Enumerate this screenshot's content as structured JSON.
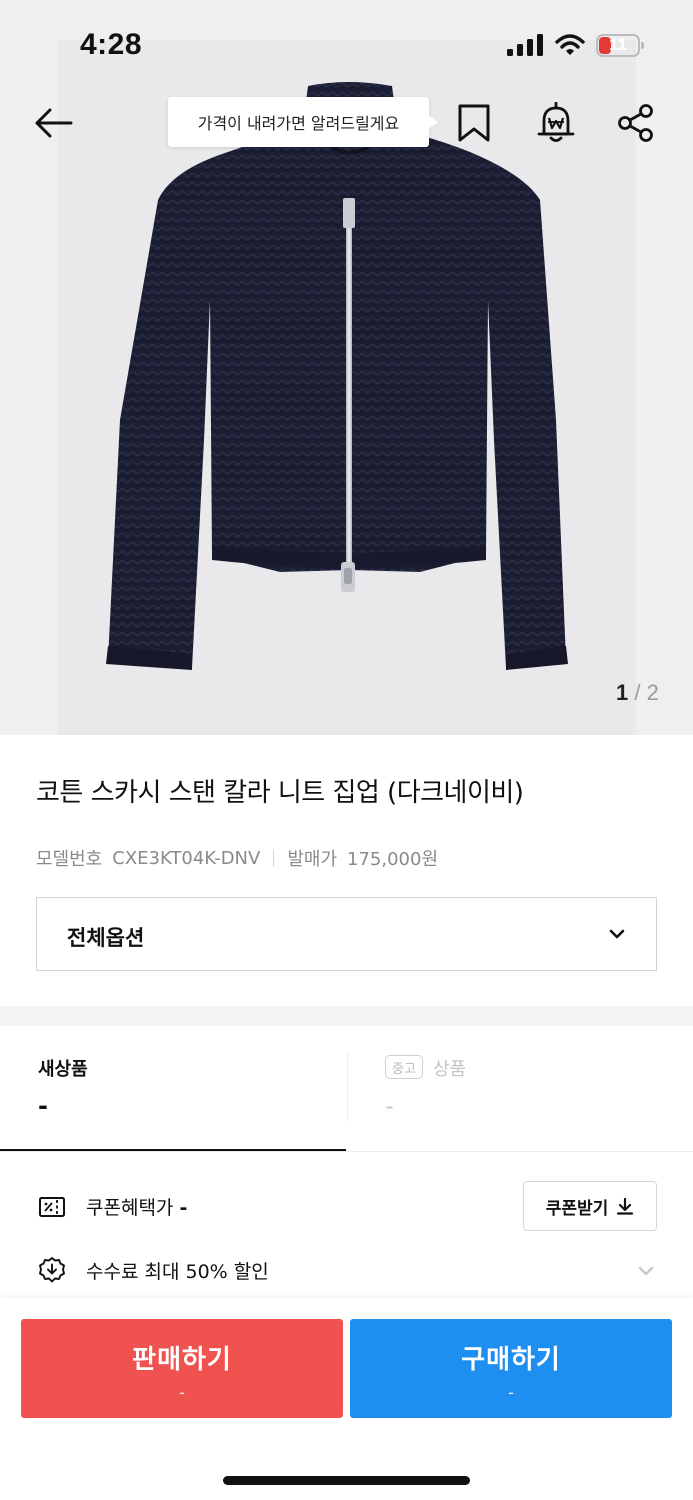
{
  "status_bar": {
    "time": "4:28",
    "battery": "11"
  },
  "nav": {
    "back_icon": "arrow-left-icon",
    "tooltip": "가격이 내려가면 알려드릴게요",
    "bookmark_icon": "bookmark-icon",
    "price_alert_icon": "price-alert-bell-icon",
    "share_icon": "share-icon"
  },
  "gallery": {
    "current": "1",
    "separator": "/",
    "total": "2"
  },
  "product": {
    "title": "코튼 스카시 스탠 칼라 니트 집업 (다크네이비)",
    "model_label": "모델번호",
    "model_number": "CXE3KT04K-DNV",
    "release_label": "발매가",
    "release_price": "175,000원"
  },
  "option_select": {
    "label": "전체옵션",
    "icon": "chevron-down-icon"
  },
  "tabs": {
    "new": {
      "label": "새상품",
      "price": "-"
    },
    "used": {
      "badge": "중고",
      "label": "상품",
      "price": "-"
    }
  },
  "benefits": {
    "coupon_label": "쿠폰혜택가",
    "coupon_value": "-",
    "coupon_button": "쿠폰받기",
    "fee_text": "수수료 최대 50% 할인"
  },
  "actions": {
    "sell_label": "판매하기",
    "sell_price": "-",
    "buy_label": "구매하기",
    "buy_price": "-"
  },
  "colors": {
    "sell": "#f0524f",
    "buy": "#1f8ef1",
    "battery_low": "#e53935",
    "garment": "#1c1f33"
  }
}
